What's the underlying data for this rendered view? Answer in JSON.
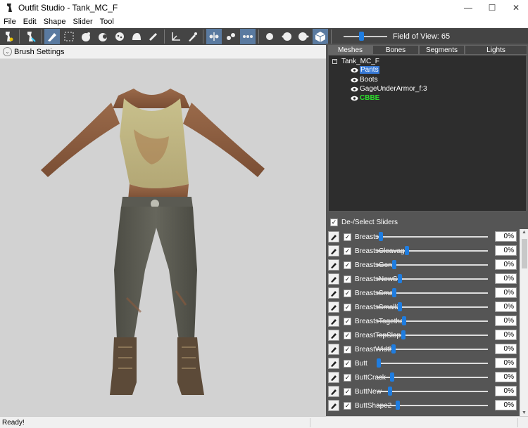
{
  "window": {
    "title": "Outfit Studio - Tank_MC_F",
    "minimize": "—",
    "maximize": "☐",
    "close": "✕"
  },
  "menu": [
    "File",
    "Edit",
    "Shape",
    "Slider",
    "Tool"
  ],
  "toolbar": {
    "fov_label": "Field of View: 65",
    "fov_level": 0.4
  },
  "brush_settings": {
    "label": "Brush Settings"
  },
  "tabs": [
    "Meshes",
    "Bones",
    "Segments",
    "Lights"
  ],
  "tree": {
    "root": "Tank_MC_F",
    "items": [
      {
        "label": "Pants",
        "state": "selected"
      },
      {
        "label": "Boots",
        "state": "normal"
      },
      {
        "label": "GageUnderArmor_f:3",
        "state": "normal"
      },
      {
        "label": "CBBE",
        "state": "reference"
      }
    ]
  },
  "sliders_header": {
    "label": "De-/Select Sliders",
    "checked": true
  },
  "sliders": [
    {
      "name": "Breasts",
      "value": "0%",
      "pos": 0.02
    },
    {
      "name": "BreastsCleavage",
      "value": "0%",
      "pos": 0.25
    },
    {
      "name": "BreastsGone",
      "value": "0%",
      "pos": 0.14
    },
    {
      "name": "BreastsNewSH",
      "value": "0%",
      "pos": 0.19
    },
    {
      "name": "BreastsSmall",
      "value": "0%",
      "pos": 0.14
    },
    {
      "name": "BreastsSmall2",
      "value": "0%",
      "pos": 0.19
    },
    {
      "name": "BreastsTogether",
      "value": "0%",
      "pos": 0.23
    },
    {
      "name": "BreastTopSlope",
      "value": "0%",
      "pos": 0.22
    },
    {
      "name": "BreastWidth",
      "value": "0%",
      "pos": 0.13
    },
    {
      "name": "Butt",
      "value": "0%",
      "pos": 0.0
    },
    {
      "name": "ButtCrack",
      "value": "0%",
      "pos": 0.12
    },
    {
      "name": "ButtNew",
      "value": "0%",
      "pos": 0.1
    },
    {
      "name": "ButtShape2",
      "value": "0%",
      "pos": 0.17
    }
  ],
  "status": {
    "text": "Ready!"
  },
  "colors": {
    "toolbar": "#444444",
    "panel": "#555555",
    "accent": "#1f7de0",
    "selection": "#3779d6",
    "reference": "#2de02d",
    "viewport": "#d2d2d2"
  }
}
